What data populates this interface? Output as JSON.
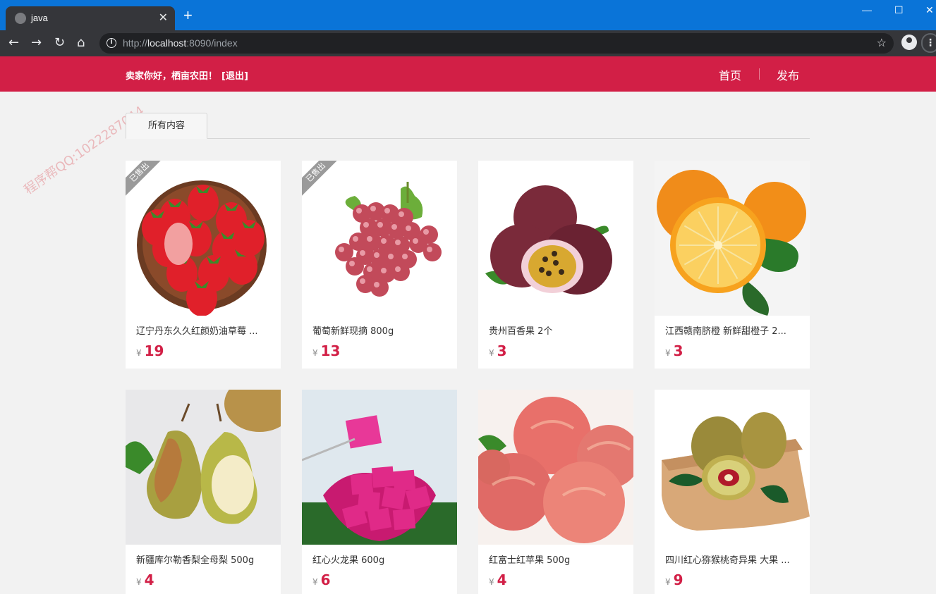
{
  "browser": {
    "tab_title": "java",
    "new_tab": "+",
    "url_prefix": "http://",
    "url_host": "localhost",
    "url_rest": ":8090/index",
    "window_min": "—",
    "window_max": "☐",
    "window_close": "✕",
    "back": "←",
    "forward": "→",
    "reload": "↻",
    "home": "⌂",
    "star": "☆",
    "menu": "⋮"
  },
  "header": {
    "greeting": "卖家你好，栖亩农田！",
    "logout": "[退出]",
    "nav_home": "首页",
    "nav_publish": "发布",
    "brand_color": "#d21f46"
  },
  "tabs": {
    "all": "所有内容"
  },
  "watermark": "程序帮QQ:1022287044",
  "currency": "¥",
  "products": [
    {
      "name": "辽宁丹东久久红颜奶油草莓 ...",
      "price": "19",
      "sold_label": "已售出",
      "sold": true,
      "image": "strawberry"
    },
    {
      "name": "葡萄新鲜现摘 800g",
      "price": "13",
      "sold_label": "已售出",
      "sold": true,
      "image": "grape"
    },
    {
      "name": "贵州百香果 2个",
      "price": "3",
      "sold": false,
      "image": "passionfruit"
    },
    {
      "name": "江西赣南脐橙 新鲜甜橙子 2...",
      "price": "3",
      "sold": false,
      "image": "orange"
    },
    {
      "name": "新疆库尔勒香梨全母梨 500g",
      "price": "4",
      "sold": false,
      "image": "pear"
    },
    {
      "name": "红心火龙果 600g",
      "price": "6",
      "sold": false,
      "image": "dragonfruit"
    },
    {
      "name": "红富士红苹果 500g",
      "price": "4",
      "sold": false,
      "image": "apple"
    },
    {
      "name": "四川红心猕猴桃奇异果 大果 ...",
      "price": "9",
      "sold": false,
      "image": "kiwi"
    }
  ]
}
